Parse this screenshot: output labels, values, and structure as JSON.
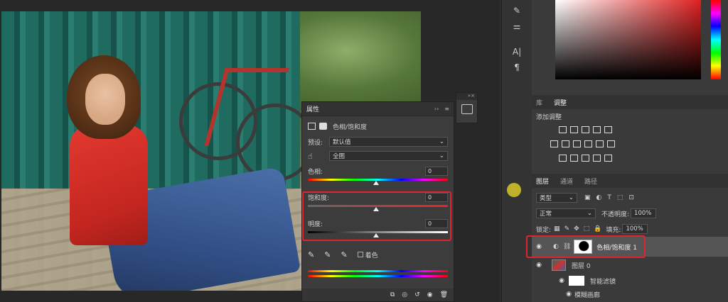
{
  "properties": {
    "tab_label": "属性",
    "adjustment_title": "色相/饱和度",
    "preset_label": "预设:",
    "preset_value": "默认值",
    "channel_value": "全图",
    "hue_label": "色相:",
    "hue_value": "0",
    "saturation_label": "饱和度:",
    "saturation_value": "0",
    "lightness_label": "明度:",
    "lightness_value": "0",
    "colorize_label": "着色"
  },
  "adjustments_panel": {
    "tabs": [
      "库",
      "调整"
    ],
    "add_adjustment_label": "添加调整"
  },
  "layers_panel": {
    "tabs": [
      "图层",
      "通道",
      "路径"
    ],
    "filter_kind": "类型",
    "blend_mode": "正常",
    "opacity_label": "不透明度:",
    "opacity_value": "100%",
    "lock_label": "锁定:",
    "fill_label": "填充:",
    "fill_value": "100%",
    "layers": [
      {
        "name": "色相/饱和度 1",
        "type": "adjustment"
      },
      {
        "name": "图层 0",
        "type": "smart-object"
      },
      {
        "name": "智能滤镜",
        "type": "smart-filter"
      },
      {
        "name": "模糊画廊",
        "type": "filter"
      }
    ]
  },
  "colors": {
    "highlight": "#e3232a",
    "panel_bg": "#3c3c3c"
  }
}
